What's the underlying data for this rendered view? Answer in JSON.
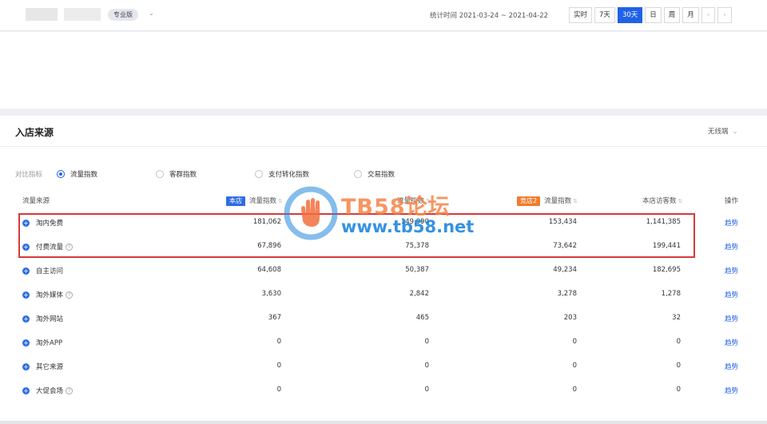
{
  "header": {
    "edition": "专业版",
    "stat_range": "统计时间 2021-03-24 ~ 2021-04-22",
    "tabs": [
      "实时",
      "7天",
      "30天",
      "日",
      "周",
      "月"
    ],
    "active_tab": "30天",
    "prev_icon": "chevron-left-icon",
    "next_icon": "chevron-right-icon"
  },
  "section": {
    "title": "入店来源",
    "device": "无线端"
  },
  "metrics": {
    "label": "对比指标",
    "options": [
      "流量指数",
      "客群指数",
      "支付转化指数",
      "交易指数"
    ],
    "selected": "流量指数"
  },
  "table": {
    "headers": {
      "source": "流量来源",
      "shop_tag": "本店",
      "shop_metric": "流量指数",
      "comp1_metric": "流量指数",
      "comp2_tag": "竞店2",
      "comp2_metric": "流量指数",
      "visitors": "本店访客数",
      "action": "操作"
    },
    "rows": [
      {
        "name": "淘内免费",
        "help": false,
        "shop": "181,062",
        "comp1": "149,990",
        "comp2": "153,434",
        "visitors": "1,141,385",
        "action": "趋势"
      },
      {
        "name": "付费流量",
        "help": true,
        "shop": "67,896",
        "comp1": "75,378",
        "comp2": "73,642",
        "visitors": "199,441",
        "action": "趋势"
      },
      {
        "name": "自主访问",
        "help": false,
        "shop": "64,608",
        "comp1": "50,387",
        "comp2": "49,234",
        "visitors": "182,695",
        "action": "趋势"
      },
      {
        "name": "淘外媒体",
        "help": true,
        "shop": "3,630",
        "comp1": "2,842",
        "comp2": "3,278",
        "visitors": "1,278",
        "action": "趋势"
      },
      {
        "name": "淘外网站",
        "help": false,
        "shop": "367",
        "comp1": "465",
        "comp2": "203",
        "visitors": "32",
        "action": "趋势"
      },
      {
        "name": "淘外APP",
        "help": false,
        "shop": "0",
        "comp1": "0",
        "comp2": "0",
        "visitors": "0",
        "action": "趋势"
      },
      {
        "name": "其它来源",
        "help": false,
        "shop": "0",
        "comp1": "0",
        "comp2": "0",
        "visitors": "0",
        "action": "趋势"
      },
      {
        "name": "大促会场",
        "help": true,
        "shop": "0",
        "comp1": "0",
        "comp2": "0",
        "visitors": "0",
        "action": "趋势"
      }
    ]
  },
  "watermark": {
    "brand": "TB58论坛",
    "url": "www.tb58.net"
  },
  "colors": {
    "accent": "#2062e6",
    "shop_tag": "#2f6ce5",
    "comp2_tag": "#f07c2d",
    "highlight": "#d63a3a"
  }
}
